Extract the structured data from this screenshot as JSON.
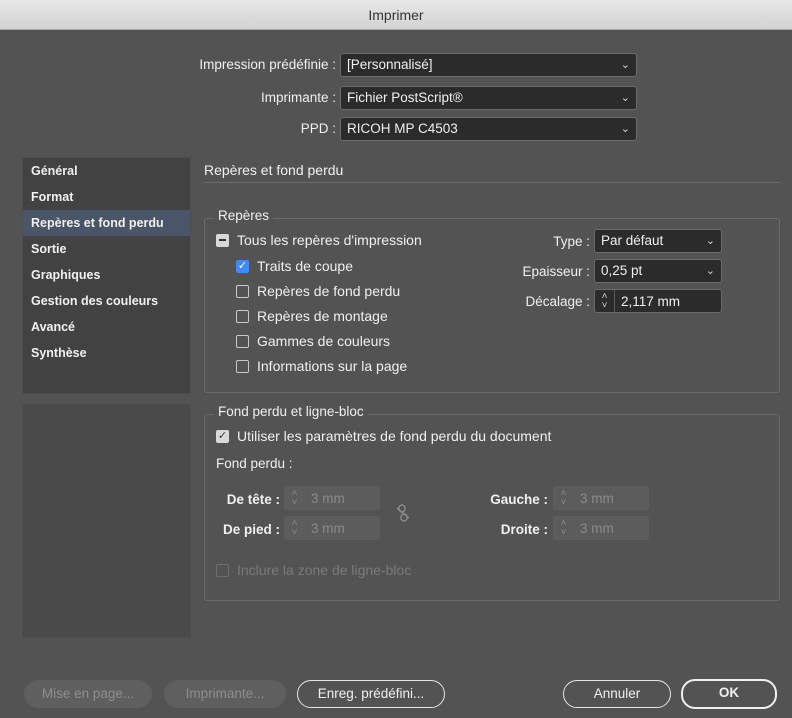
{
  "window": {
    "title": "Imprimer"
  },
  "presets": {
    "preset_label": "Impression prédéfinie :",
    "preset_value": "[Personnalisé]",
    "printer_label": "Imprimante :",
    "printer_value": "Fichier PostScript®",
    "ppd_label": "PPD :",
    "ppd_value": "RICOH MP C4503"
  },
  "sidebar": {
    "items": [
      {
        "label": "Général"
      },
      {
        "label": "Format"
      },
      {
        "label": "Repères et fond perdu"
      },
      {
        "label": "Sortie"
      },
      {
        "label": "Graphiques"
      },
      {
        "label": "Gestion des couleurs"
      },
      {
        "label": "Avancé"
      },
      {
        "label": "Synthèse"
      }
    ],
    "selected_index": 2
  },
  "main": {
    "section_title": "Repères et fond perdu",
    "marks": {
      "title": "Repères",
      "all_marks": "Tous les repères d'impression",
      "crop_marks": "Traits de coupe",
      "bleed_marks": "Repères de fond perdu",
      "registration_marks": "Repères de montage",
      "color_bars": "Gammes de couleurs",
      "page_info": "Informations sur la page",
      "type_label": "Type :",
      "type_value": "Par défaut",
      "weight_label": "Epaisseur :",
      "weight_value": "0,25 pt",
      "offset_label": "Décalage :",
      "offset_value": "2,117 mm"
    },
    "bleed": {
      "title": "Fond perdu et ligne-bloc",
      "use_doc_settings": "Utiliser les paramètres de fond perdu du document",
      "bleed_label": "Fond perdu :",
      "top_label": "De tête :",
      "top_value": "3 mm",
      "bottom_label": "De pied :",
      "bottom_value": "3 mm",
      "left_label": "Gauche :",
      "left_value": "3 mm",
      "right_label": "Droite :",
      "right_value": "3 mm",
      "include_slug": "Inclure la zone de ligne-bloc"
    }
  },
  "footer": {
    "page_setup": "Mise en page...",
    "printer": "Imprimante...",
    "save_preset": "Enreg. prédéfini...",
    "cancel": "Annuler",
    "ok": "OK"
  },
  "colors": {
    "background": "#535353",
    "accent": "#3d8bf7",
    "selection": "#4a5568"
  }
}
